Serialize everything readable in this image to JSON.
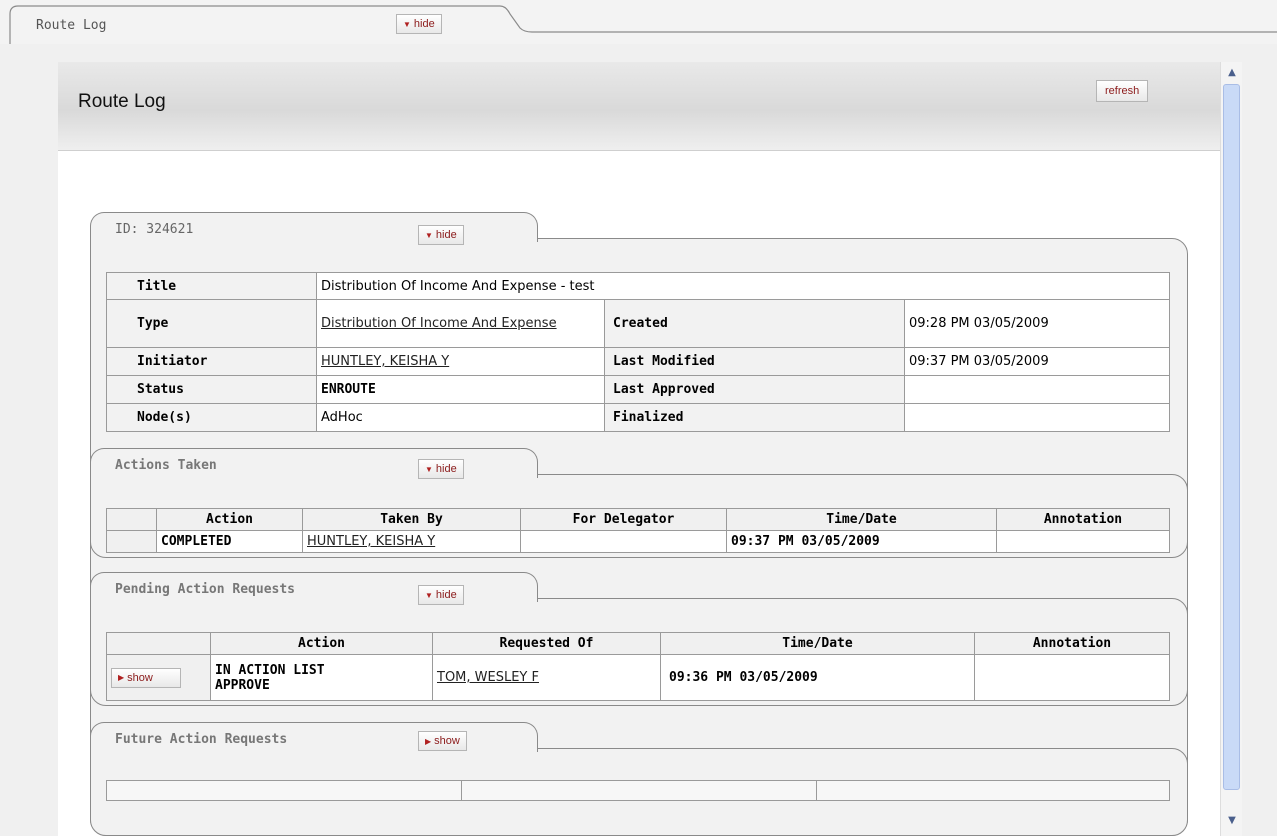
{
  "outer_tab": {
    "label": "Route Log",
    "hide_label": "hide"
  },
  "panel": {
    "title": "Route Log",
    "refresh_label": "refresh"
  },
  "document": {
    "id_label": "ID: 324621",
    "hide_label": "hide",
    "fields": {
      "title_label": "Title",
      "title_value": "Distribution Of Income And Expense - test",
      "type_label": "Type",
      "type_value": "Distribution Of Income And Expense",
      "created_label": "Created",
      "created_value": "09:28 PM 03/05/2009",
      "initiator_label": "Initiator",
      "initiator_value": "HUNTLEY, KEISHA Y",
      "last_modified_label": "Last Modified",
      "last_modified_value": "09:37 PM 03/05/2009",
      "status_label": "Status",
      "status_value": "ENROUTE",
      "last_approved_label": "Last Approved",
      "last_approved_value": "",
      "nodes_label": "Node(s)",
      "nodes_value": "AdHoc",
      "finalized_label": "Finalized",
      "finalized_value": ""
    }
  },
  "actions_taken": {
    "title": "Actions Taken",
    "hide_label": "hide",
    "columns": [
      "",
      "Action",
      "Taken By",
      "For Delegator",
      "Time/Date",
      "Annotation"
    ],
    "rows": [
      {
        "action": "COMPLETED",
        "taken_by": "HUNTLEY, KEISHA Y",
        "for_delegator": "",
        "time_date": "09:37 PM 03/05/2009",
        "annotation": ""
      }
    ]
  },
  "pending": {
    "title": "Pending Action Requests",
    "hide_label": "hide",
    "columns": [
      "",
      "Action",
      "Requested Of",
      "Time/Date",
      "Annotation"
    ],
    "rows": [
      {
        "show_label": "show",
        "action_line1": "IN ACTION LIST",
        "action_line2": "APPROVE",
        "requested_of": "TOM, WESLEY F",
        "time_date": "09:36 PM 03/05/2009",
        "annotation": ""
      }
    ]
  },
  "future": {
    "title": "Future Action Requests",
    "show_label": "show"
  },
  "colors": {
    "accent_text": "#8b1a1a",
    "scroll_thumb": "#c9daf7"
  },
  "icons": [
    "triangle-down-icon",
    "triangle-right-icon",
    "scroll-up-icon",
    "scroll-down-icon"
  ]
}
